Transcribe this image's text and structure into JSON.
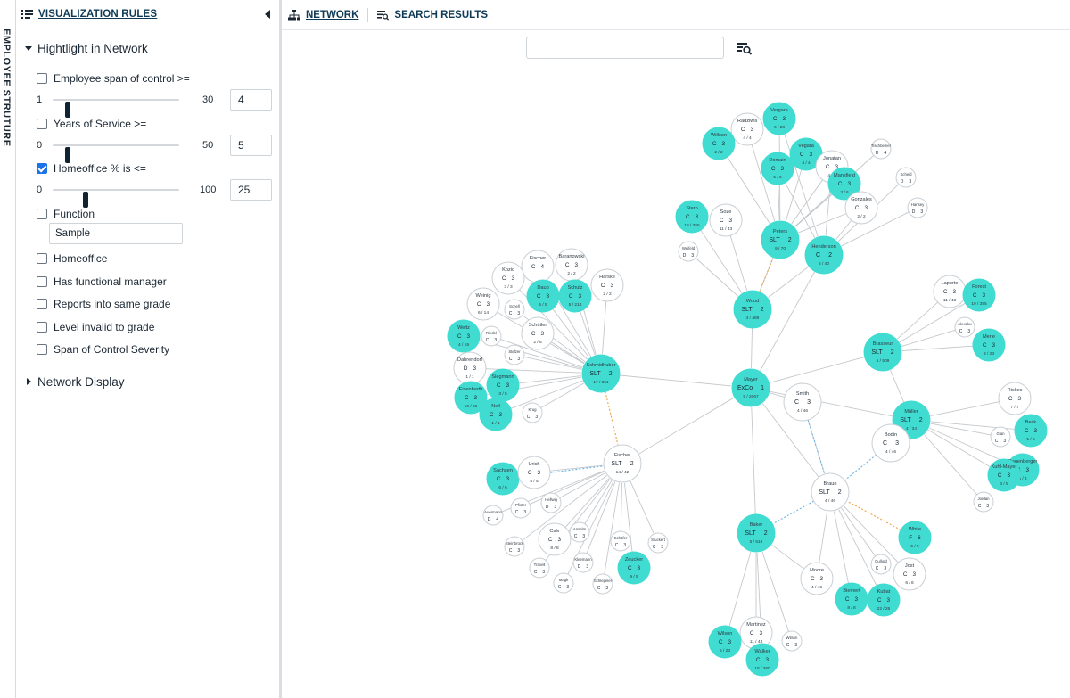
{
  "sidebar": {
    "vertical_label": "EMPLOYEE STRUTURE",
    "title": "VISUALIZATION RULES",
    "section_highlight": "Hightlight in Network",
    "section_display": "Network Display",
    "rules": {
      "span": {
        "label": "Employee span of control >=",
        "checked": false,
        "min": "1",
        "max": "30",
        "value": "4",
        "fraction": 0.1
      },
      "service": {
        "label": "Years of Service >=",
        "checked": false,
        "min": "0",
        "max": "50",
        "value": "5",
        "fraction": 0.1
      },
      "homeoffice_pct": {
        "label": "Homeoffice % is <=",
        "checked": true,
        "min": "0",
        "max": "100",
        "value": "25",
        "fraction": 0.25
      },
      "function": {
        "label": "Function",
        "checked": false,
        "value": "Sample"
      },
      "homeoffice": {
        "label": "Homeoffice",
        "checked": false
      },
      "functional_manager": {
        "label": "Has functional manager",
        "checked": false
      },
      "same_grade": {
        "label": "Reports into same grade",
        "checked": false
      },
      "level_invalid": {
        "label": "Level invalid to grade",
        "checked": false
      },
      "soc_severity": {
        "label": "Span of Control Severity",
        "checked": false
      }
    }
  },
  "tabs": {
    "network": "NETWORK",
    "search": "SEARCH RESULTS"
  },
  "search": {
    "value": ""
  },
  "colors": {
    "highlight": "#40dcd2",
    "node": "#ffffff",
    "stroke": "#c9cfd4",
    "edge": "#c4c8cc",
    "edge_orange": "#f0a040",
    "edge_blue": "#6ab6e6"
  },
  "network": {
    "nodes": [
      {
        "id": "mayer",
        "name": "Mayer",
        "grade": "ExCo",
        "lvl": "1",
        "stats": "9 / 2067",
        "hl": true,
        "big": true
      },
      {
        "id": "wood",
        "name": "Wood",
        "grade": "SLT",
        "lvl": "2",
        "stats": "4 / 489",
        "hl": true,
        "big": true
      },
      {
        "id": "peters",
        "name": "Peters",
        "grade": "SLT",
        "lvl": "2",
        "stats": "9 / 70",
        "hl": true,
        "big": true
      },
      {
        "id": "henderson",
        "name": "Henderson",
        "grade": "C",
        "lvl": "2",
        "stats": "6 / 40",
        "hl": true,
        "big": true
      },
      {
        "id": "schmidhuber",
        "name": "Schmidhuber",
        "grade": "SLT",
        "lvl": "2",
        "stats": "17 / 351",
        "hl": true,
        "big": true
      },
      {
        "id": "brasseur",
        "name": "Brasseur",
        "grade": "SLT",
        "lvl": "2",
        "stats": "5 / 509",
        "hl": true,
        "big": true
      },
      {
        "id": "mueller",
        "name": "Müller",
        "grade": "SLT",
        "lvl": "2",
        "stats": "4 / 34",
        "hl": true,
        "big": true
      },
      {
        "id": "baker",
        "name": "Baker",
        "grade": "SLT",
        "lvl": "2",
        "stats": "5 / 510",
        "hl": true,
        "big": true
      },
      {
        "id": "fischer2",
        "name": "Fischer",
        "grade": "SLT",
        "lvl": "2",
        "stats": "14 / 42",
        "hl": false,
        "big": true
      },
      {
        "id": "braun",
        "name": "Braun",
        "grade": "SLT",
        "lvl": "2",
        "stats": "4 / 46",
        "hl": false,
        "big": true
      },
      {
        "id": "smith",
        "name": "Smith",
        "grade": "C",
        "lvl": "3",
        "stats": "4 / 46",
        "hl": false,
        "big": true
      },
      {
        "id": "bodin",
        "name": "Bodin",
        "grade": "C",
        "lvl": "3",
        "stats": "4 / 46",
        "hl": false,
        "big": true
      },
      {
        "id": "vergara1",
        "name": "Vergara",
        "grade": "C",
        "lvl": "3",
        "stats": "6 / 28",
        "hl": true
      },
      {
        "id": "radziwill",
        "name": "Radziwill",
        "grade": "C",
        "lvl": "3",
        "stats": "4 / 4",
        "hl": false
      },
      {
        "id": "willson",
        "name": "Willson",
        "grade": "C",
        "lvl": "3",
        "stats": "2 / 2",
        "hl": true
      },
      {
        "id": "vegara2",
        "name": "Vegara",
        "grade": "C",
        "lvl": "3",
        "stats": "4 / 4",
        "hl": true
      },
      {
        "id": "domain",
        "name": "Domain",
        "grade": "C",
        "lvl": "3",
        "stats": "5 / 6",
        "hl": true
      },
      {
        "id": "jonatan",
        "name": "Jonatan",
        "grade": "C",
        "lvl": "3",
        "stats": "4 / 4",
        "hl": false
      },
      {
        "id": "mansfield",
        "name": "Mansfield",
        "grade": "C",
        "lvl": "3",
        "stats": "3 / 6",
        "hl": true
      },
      {
        "id": "gonzales",
        "name": "Gonzales",
        "grade": "C",
        "lvl": "3",
        "stats": "2 / 2",
        "hl": false
      },
      {
        "id": "tisch",
        "name": "Tischbeiner",
        "grade": "D",
        "lvl": "4",
        "stats": "",
        "hl": false,
        "small": true
      },
      {
        "id": "scheid",
        "name": "Scheid",
        "grade": "D",
        "lvl": "3",
        "stats": "",
        "hl": false,
        "small": true
      },
      {
        "id": "hansey",
        "name": "Hansey",
        "grade": "D",
        "lvl": "3",
        "stats": "",
        "hl": false,
        "small": true
      },
      {
        "id": "stern",
        "name": "Stern",
        "grade": "C",
        "lvl": "3",
        "stats": "18 / 355",
        "hl": true
      },
      {
        "id": "soze",
        "name": "Soze",
        "grade": "C",
        "lvl": "3",
        "stats": "11 / 43",
        "hl": false
      },
      {
        "id": "weifeld",
        "name": "Weifeld",
        "grade": "D",
        "lvl": "3",
        "stats": "",
        "hl": false,
        "small": true
      },
      {
        "id": "laporte",
        "name": "Laporte",
        "grade": "C",
        "lvl": "3",
        "stats": "11 / 43",
        "hl": false
      },
      {
        "id": "forest",
        "name": "Forest",
        "grade": "C",
        "lvl": "3",
        "stats": "19 / 355",
        "hl": true
      },
      {
        "id": "alexaku",
        "name": "Alexaku",
        "grade": "C",
        "lvl": "3",
        "stats": "",
        "hl": false,
        "small": true
      },
      {
        "id": "merle",
        "name": "Merle",
        "grade": "C",
        "lvl": "3",
        "stats": "3 / 23",
        "hl": true
      },
      {
        "id": "rickes",
        "name": "Rickes",
        "grade": "C",
        "lvl": "3",
        "stats": "7 / 7",
        "hl": false
      },
      {
        "id": "beck",
        "name": "Beck",
        "grade": "C",
        "lvl": "3",
        "stats": "5 / 6",
        "hl": true
      },
      {
        "id": "gian",
        "name": "Gian",
        "grade": "C",
        "lvl": "3",
        "stats": "",
        "hl": false,
        "small": true
      },
      {
        "id": "rauen",
        "name": "Rauenberger",
        "grade": "C",
        "lvl": "3",
        "stats": "4 / 4",
        "hl": true
      },
      {
        "id": "kuhl",
        "name": "Kuhl-Mayer",
        "grade": "C",
        "lvl": "3",
        "stats": "3 / 5",
        "hl": true
      },
      {
        "id": "jordan",
        "name": "Jordan",
        "grade": "C",
        "lvl": "3",
        "stats": "",
        "hl": false,
        "small": true
      },
      {
        "id": "fischer1",
        "name": "Fischer",
        "grade": "C",
        "lvl": "4",
        "stats": "",
        "hl": false
      },
      {
        "id": "baranowski",
        "name": "Baranowski",
        "grade": "C",
        "lvl": "3",
        "stats": "2 / 2",
        "hl": false
      },
      {
        "id": "harske",
        "name": "Harske",
        "grade": "C",
        "lvl": "3",
        "stats": "2 / 2",
        "hl": false
      },
      {
        "id": "kozic",
        "name": "Kozic",
        "grade": "C",
        "lvl": "3",
        "stats": "3 / 3",
        "hl": false
      },
      {
        "id": "daub",
        "name": "Daub",
        "grade": "C",
        "lvl": "3",
        "stats": "5 / 5",
        "hl": true
      },
      {
        "id": "schulz",
        "name": "Schulz",
        "grade": "C",
        "lvl": "3",
        "stats": "5 / 214",
        "hl": true
      },
      {
        "id": "weinig",
        "name": "Weinig",
        "grade": "C",
        "lvl": "3",
        "stats": "6 / 14",
        "hl": false
      },
      {
        "id": "schell",
        "name": "Schell",
        "grade": "C",
        "lvl": "3",
        "stats": "",
        "hl": false,
        "small": true
      },
      {
        "id": "schuetler",
        "name": "Schütler",
        "grade": "C",
        "lvl": "3",
        "stats": "2 / 6",
        "hl": false
      },
      {
        "id": "weltz",
        "name": "Weltz",
        "grade": "C",
        "lvl": "3",
        "stats": "4 / 19",
        "hl": true
      },
      {
        "id": "riedel",
        "name": "Riedel",
        "grade": "C",
        "lvl": "3",
        "stats": "",
        "hl": false,
        "small": true
      },
      {
        "id": "stelzer",
        "name": "Stelzer",
        "grade": "C",
        "lvl": "3",
        "stats": "",
        "hl": false,
        "small": true
      },
      {
        "id": "dahrendorf",
        "name": "Dahrendorf",
        "grade": "D",
        "lvl": "3",
        "stats": "1 / 1",
        "hl": false
      },
      {
        "id": "siegmann",
        "name": "Siegmann",
        "grade": "C",
        "lvl": "3",
        "stats": "3 / 5",
        "hl": true
      },
      {
        "id": "eisenbarth",
        "name": "Eisenbarth",
        "grade": "C",
        "lvl": "3",
        "stats": "10 / 66",
        "hl": true
      },
      {
        "id": "nell",
        "name": "Nell",
        "grade": "C",
        "lvl": "3",
        "stats": "1 / 1",
        "hl": true
      },
      {
        "id": "krug",
        "name": "Krug",
        "grade": "C",
        "lvl": "3",
        "stats": "",
        "hl": false,
        "small": true
      },
      {
        "id": "sachsen",
        "name": "Sachsen",
        "grade": "C",
        "lvl": "3",
        "stats": "6 / 6",
        "hl": true
      },
      {
        "id": "urich",
        "name": "Urich",
        "grade": "C",
        "lvl": "3",
        "stats": "5 / 5",
        "hl": false
      },
      {
        "id": "hellwig",
        "name": "Hellwig",
        "grade": "D",
        "lvl": "3",
        "stats": "",
        "hl": false,
        "small": true
      },
      {
        "id": "pfister",
        "name": "Pfister",
        "grade": "C",
        "lvl": "3",
        "stats": "",
        "hl": false,
        "small": true
      },
      {
        "id": "auerman",
        "name": "Auermann",
        "grade": "D",
        "lvl": "4",
        "stats": "",
        "hl": false,
        "small": true
      },
      {
        "id": "calv",
        "name": "Calv",
        "grade": "C",
        "lvl": "3",
        "stats": "8 / 8",
        "hl": false
      },
      {
        "id": "anselm",
        "name": "Anselm",
        "grade": "C",
        "lvl": "3",
        "stats": "",
        "hl": false,
        "small": true
      },
      {
        "id": "steinbruck",
        "name": "Steinbrück",
        "grade": "C",
        "lvl": "3",
        "stats": "",
        "hl": false,
        "small": true
      },
      {
        "id": "schaefer",
        "name": "Schäfer",
        "grade": "C",
        "lvl": "3",
        "stats": "",
        "hl": false,
        "small": true
      },
      {
        "id": "stuckert",
        "name": "Stuckert",
        "grade": "C",
        "lvl": "3",
        "stats": "",
        "hl": false,
        "small": true
      },
      {
        "id": "zeucker",
        "name": "Zeucker",
        "grade": "C",
        "lvl": "3",
        "stats": "9 / 9",
        "hl": true
      },
      {
        "id": "traxell",
        "name": "Traxell",
        "grade": "C",
        "lvl": "3",
        "stats": "",
        "hl": false,
        "small": true
      },
      {
        "id": "kleemann",
        "name": "Kleemann",
        "grade": "D",
        "lvl": "3",
        "stats": "",
        "hl": false,
        "small": true
      },
      {
        "id": "magk",
        "name": "Magk",
        "grade": "C",
        "lvl": "3",
        "stats": "",
        "hl": false,
        "small": true
      },
      {
        "id": "schlepeler",
        "name": "Schlepeler",
        "grade": "C",
        "lvl": "3",
        "stats": "",
        "hl": false,
        "small": true
      },
      {
        "id": "white",
        "name": "White",
        "grade": "F",
        "lvl": "6",
        "stats": "5 / 9",
        "hl": true
      },
      {
        "id": "gullord",
        "name": "Gullord",
        "grade": "C",
        "lvl": "3",
        "stats": "",
        "hl": false,
        "small": true
      },
      {
        "id": "jost",
        "name": "Jost",
        "grade": "C",
        "lvl": "3",
        "stats": "6 / 6",
        "hl": false
      },
      {
        "id": "moore",
        "name": "Moore",
        "grade": "C",
        "lvl": "3",
        "stats": "4 / 46",
        "hl": false
      },
      {
        "id": "biemert",
        "name": "Biemert",
        "grade": "C",
        "lvl": "3",
        "stats": "8 / 8",
        "hl": true
      },
      {
        "id": "kubat",
        "name": "Kubat",
        "grade": "C",
        "lvl": "3",
        "stats": "22 / 26",
        "hl": true
      },
      {
        "id": "martinez",
        "name": "Martinez",
        "grade": "C",
        "lvl": "3",
        "stats": "11 / 43",
        "hl": false
      },
      {
        "id": "wilson",
        "name": "Wilson",
        "grade": "C",
        "lvl": "3",
        "stats": "5 / 23",
        "hl": true
      },
      {
        "id": "wilsson",
        "name": "Wilson",
        "grade": "C",
        "lvl": "3",
        "stats": "",
        "hl": false,
        "small": true
      },
      {
        "id": "walker",
        "name": "Walker",
        "grade": "C",
        "lvl": "3",
        "stats": "18 / 360",
        "hl": true
      }
    ]
  }
}
